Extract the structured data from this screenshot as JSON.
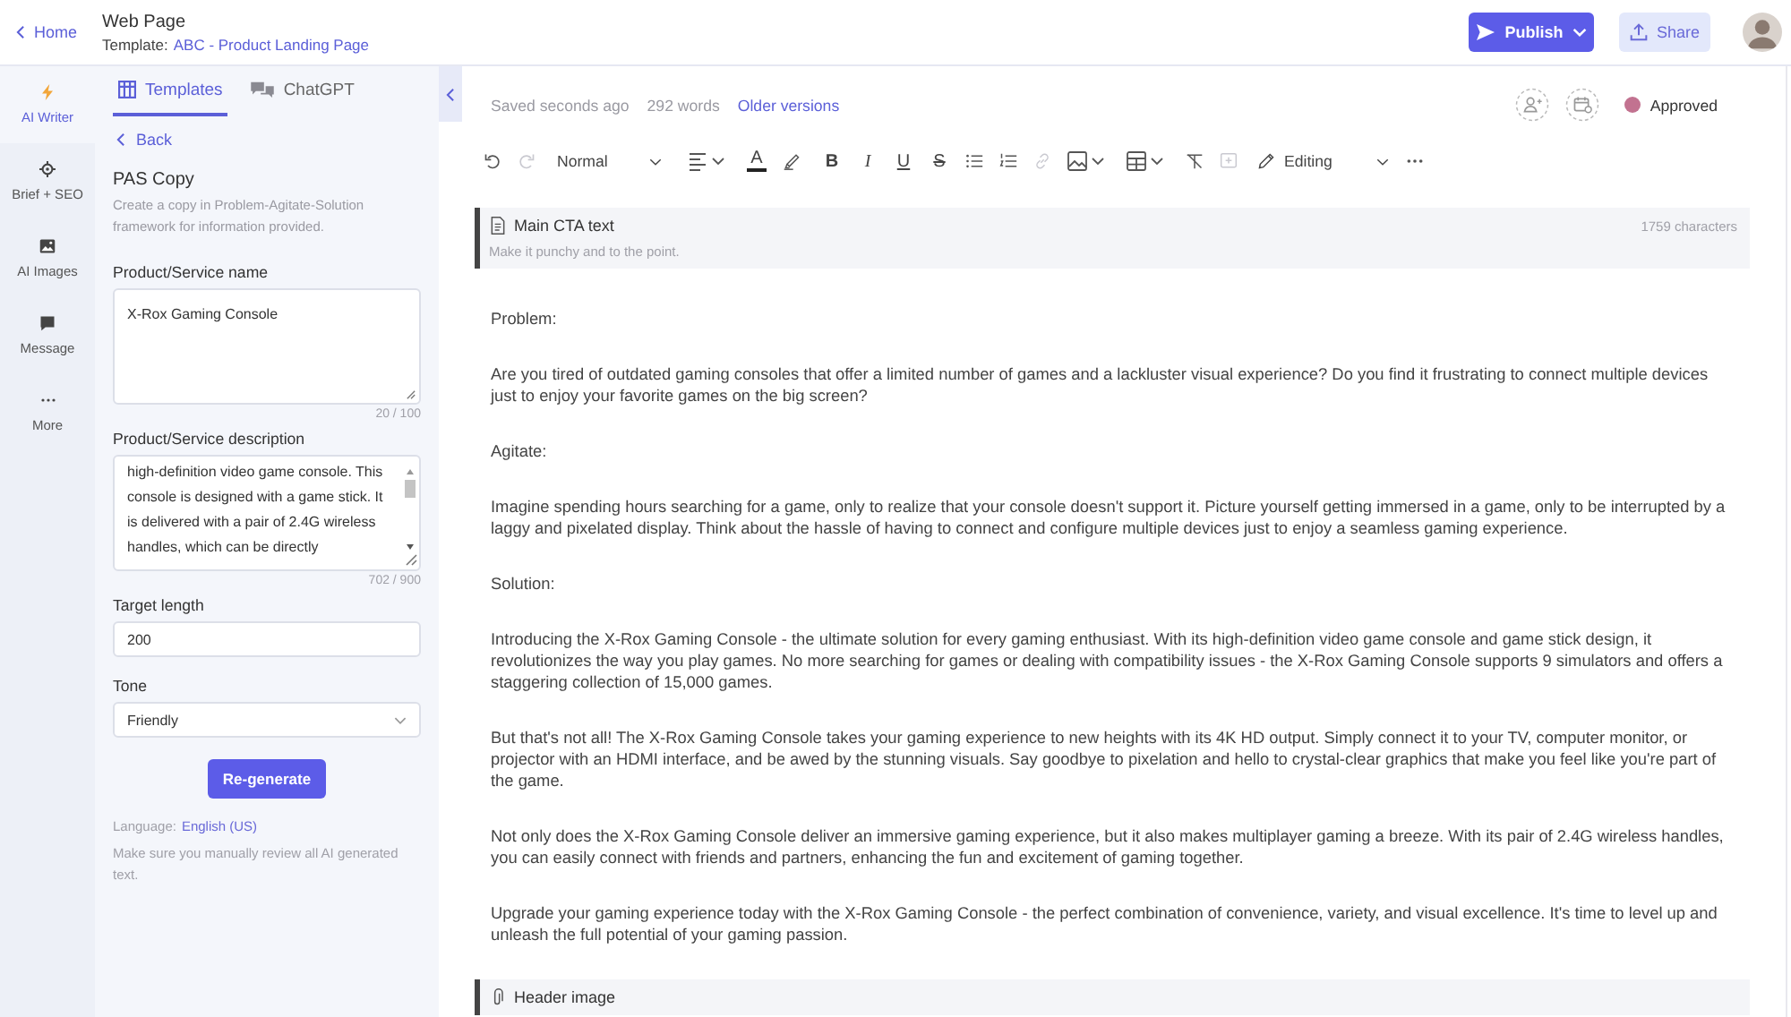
{
  "topbar": {
    "back": "Home",
    "title": "Web Page",
    "template_label": "Template:",
    "template_name": "ABC - Product Landing Page",
    "publish": "Publish",
    "share": "Share"
  },
  "rail": {
    "items": [
      {
        "label": "AI Writer",
        "selected": true
      },
      {
        "label": "Brief + SEO",
        "selected": false
      },
      {
        "label": "AI Images",
        "selected": false
      },
      {
        "label": "Message",
        "selected": false
      },
      {
        "label": "More",
        "selected": false
      }
    ]
  },
  "panel": {
    "tabs": [
      {
        "label": "Templates",
        "selected": true
      },
      {
        "label": "ChatGPT",
        "selected": false
      }
    ],
    "back": "Back",
    "title": "PAS Copy",
    "description": "Create a copy in Problem-Agitate-Solution framework for information provided.",
    "fields": [
      {
        "kind": "textarea",
        "label": "Product/Service name",
        "value": "X-Rox Gaming Console",
        "counter": "20 / 100"
      },
      {
        "kind": "scroll_textarea",
        "label": "Product/Service description",
        "value": "high-definition video game console. This console is designed with a game stick. It is delivered with a pair of 2.4G wireless handles, which can be directly",
        "counter": "702 / 900"
      },
      {
        "kind": "input",
        "label": "Target length",
        "value": "200"
      },
      {
        "kind": "select",
        "label": "Tone",
        "value": "Friendly"
      }
    ],
    "button": "Re-generate",
    "language_label": "Language:",
    "language": "English (US)",
    "note": "Make sure you manually review all AI generated text."
  },
  "editor": {
    "saved": "Saved seconds ago",
    "words": "292 words",
    "versions": "Older versions",
    "approval": {
      "label": "Approved",
      "color": "#c27290"
    },
    "toolbar": [
      {
        "kind": "undo",
        "disabled": false
      },
      {
        "kind": "redo",
        "disabled": true
      },
      {
        "kind": "style",
        "label": "Normal",
        "disabled": false
      },
      {
        "kind": "align",
        "disabled": false
      },
      {
        "kind": "text_color",
        "label": "A",
        "disabled": false
      },
      {
        "kind": "highlight",
        "disabled": false
      },
      {
        "kind": "bold",
        "label": "B",
        "disabled": false
      },
      {
        "kind": "italic",
        "label": "I",
        "disabled": false
      },
      {
        "kind": "underline",
        "label": "U",
        "disabled": false
      },
      {
        "kind": "strike",
        "label": "S",
        "disabled": false
      },
      {
        "kind": "bullets",
        "disabled": false
      },
      {
        "kind": "numbers",
        "disabled": false
      },
      {
        "kind": "link",
        "disabled": true
      },
      {
        "kind": "image",
        "disabled": false
      },
      {
        "kind": "table",
        "disabled": false
      },
      {
        "kind": "clear",
        "disabled": false
      },
      {
        "kind": "comment",
        "disabled": true
      },
      {
        "kind": "mode",
        "label": "Editing",
        "disabled": false
      },
      {
        "kind": "more",
        "disabled": false
      }
    ],
    "blocks": [
      {
        "kind": "text",
        "title": "Main CTA text",
        "hint": "Make it punchy and to the point.",
        "count": "1759 characters",
        "paragraphs": [
          "Problem:",
          "Are you tired of outdated gaming consoles that offer a limited number of games and a lackluster visual experience? Do you find it frustrating to connect multiple devices just to enjoy your favorite games on the big screen?",
          "Agitate:",
          "Imagine spending hours searching for a game, only to realize that your console doesn't support it. Picture yourself getting immersed in a game, only to be interrupted by a laggy and pixelated display. Think about the hassle of having to connect and configure multiple devices just to enjoy a seamless gaming experience.",
          "Solution:",
          "Introducing the X-Rox Gaming Console - the ultimate solution for every gaming enthusiast. With its high-definition video game console and game stick design, it revolutionizes the way you play games. No more searching for games or dealing with compatibility issues - the X-Rox Gaming Console supports 9 simulators and offers a staggering collection of 15,000 games.",
          "But that's not all! The X-Rox Gaming Console takes your gaming experience to new heights with its 4K HD output. Simply connect it to your TV, computer monitor, or projector with an HDMI interface, and be awed by the stunning visuals. Say goodbye to pixelation and hello to crystal-clear graphics that make you feel like you're part of the game.",
          "Not only does the X-Rox Gaming Console deliver an immersive gaming experience, but it also makes multiplayer gaming a breeze. With its pair of 2.4G wireless handles, you can easily connect with friends and partners, enhancing the fun and excitement of gaming together.",
          "Upgrade your gaming experience today with the X-Rox Gaming Console - the perfect combination of convenience, variety, and visual excellence. It's time to level up and unleash the full potential of your gaming passion."
        ]
      },
      {
        "kind": "image",
        "title": "Header image"
      }
    ]
  }
}
